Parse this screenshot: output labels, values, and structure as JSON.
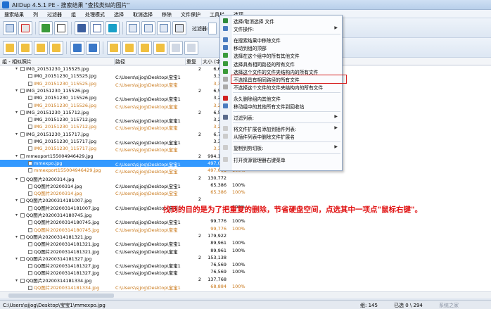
{
  "window": {
    "title": "AllDup 4.5.1 PE - 搜索结果 \"查找类似的图片\""
  },
  "menubar": [
    "搜索结果",
    "列",
    "过滤器",
    "组",
    "处理模式",
    "选择",
    "取消选择",
    "移除",
    "文件保护",
    "工具栏",
    "选项"
  ],
  "toolbar": {
    "filter_label": "过滤器:"
  },
  "columns": {
    "group": "组 - 相似照片",
    "path": "路径",
    "count": "重复",
    "size": "大小 (字节)"
  },
  "rows": [
    {
      "type": "group",
      "name": "IMG_20151230_115525.jpg",
      "count": "2",
      "size": "6,636",
      "pct": ""
    },
    {
      "type": "file",
      "name": "IMG_20151230_115525.jpg",
      "path": "C:\\Users\\sjjog\\Desktop\\宝宝1",
      "size": "3,318",
      "pct": "100%",
      "orange": false
    },
    {
      "type": "file",
      "name": "IMG_20151230_115525.jpg",
      "path": "C:\\Users\\sjjog\\Desktop\\宝宝",
      "size": "3,318",
      "pct": "100%",
      "orange": true
    },
    {
      "type": "group",
      "name": "IMG_20151230_115526.jpg",
      "count": "2",
      "size": "6,544",
      "pct": ""
    },
    {
      "type": "file",
      "name": "IMG_20151230_115526.jpg",
      "path": "C:\\Users\\sjjog\\Desktop\\宝宝1",
      "size": "3,272",
      "pct": "100%",
      "orange": false
    },
    {
      "type": "file",
      "name": "IMG_20151230_115526.jpg",
      "path": "C:\\Users\\sjjog\\Desktop\\宝宝",
      "size": "3,272",
      "pct": "100%",
      "orange": true
    },
    {
      "type": "group",
      "name": "IMG_20151230_115712.jpg",
      "count": "2",
      "size": "6,554",
      "pct": ""
    },
    {
      "type": "file",
      "name": "IMG_20151230_115712.jpg",
      "path": "C:\\Users\\sjjog\\Desktop\\宝宝1",
      "size": "3,277",
      "pct": "100%",
      "orange": false
    },
    {
      "type": "file",
      "name": "IMG_20151230_115712.jpg",
      "path": "C:\\Users\\sjjog\\Desktop\\宝宝",
      "size": "3,277",
      "pct": "100%",
      "orange": true
    },
    {
      "type": "group",
      "name": "IMG_20151230_115717.jpg",
      "count": "2",
      "size": "6,710",
      "pct": ""
    },
    {
      "type": "file",
      "name": "IMG_20151230_115717.jpg",
      "path": "C:\\Users\\sjjog\\Desktop\\宝宝1",
      "size": "3,355",
      "pct": "100%",
      "orange": false
    },
    {
      "type": "file",
      "name": "IMG_20151230_115717.jpg",
      "path": "C:\\Users\\sjjog\\Desktop\\宝宝",
      "size": "3,355",
      "pct": "100%",
      "orange": true
    },
    {
      "type": "group",
      "name": "mmexport155004946429.jpg",
      "count": "2",
      "size": "994,102",
      "pct": ""
    },
    {
      "type": "file",
      "name": "mmexpo.jpg",
      "path": "C:\\Users\\sjjog\\Desktop\\宝宝1",
      "size": "497,051",
      "pct": "100%",
      "orange": false,
      "selected": true
    },
    {
      "type": "file",
      "name": "mmexport155004946429.jpg",
      "path": "C:\\Users\\sjjog\\Desktop\\宝宝",
      "size": "497,051",
      "pct": "100%",
      "orange": true
    },
    {
      "type": "group",
      "name": "QQ图片20200314.jpg",
      "count": "2",
      "size": "130,772",
      "pct": ""
    },
    {
      "type": "file",
      "name": "QQ图片20200314.jpg",
      "path": "C:\\Users\\sjjog\\Desktop\\宝宝1",
      "size": "65,386",
      "pct": "100%",
      "orange": false
    },
    {
      "type": "file",
      "name": "QQ图片20200314.jpg",
      "path": "C:\\Users\\sjjog\\Desktop\\宝宝",
      "size": "65,386",
      "pct": "100%",
      "orange": true
    },
    {
      "type": "group",
      "name": "QQ图片20200314181007.jpg",
      "count": "2",
      "size": "",
      "pct": ""
    },
    {
      "type": "file",
      "name": "QQ图片20200314181007.jpg",
      "path": "C:\\Users\\sjjog\\Desktop\\宝宝1",
      "size": "",
      "pct": "100%",
      "orange": false
    },
    {
      "type": "group",
      "name": "QQ图片20200314180745.jpg",
      "count": "",
      "size": "",
      "pct": ""
    },
    {
      "type": "file",
      "name": "QQ图片20200314180745.jpg",
      "path": "C:\\Users\\sjjog\\Desktop\\宝宝1",
      "size": "99,776",
      "pct": "100%",
      "orange": false
    },
    {
      "type": "file",
      "name": "QQ图片20200314180745.jpg",
      "path": "C:\\Users\\sjjog\\Desktop\\宝宝",
      "size": "99,776",
      "pct": "100%",
      "orange": true
    },
    {
      "type": "group",
      "name": "QQ图片20200314181321.jpg",
      "count": "2",
      "size": "179,922",
      "pct": ""
    },
    {
      "type": "file",
      "name": "QQ图片20200314181321.jpg",
      "path": "C:\\Users\\sjjog\\Desktop\\宝宝1",
      "size": "89,961",
      "pct": "100%",
      "orange": false
    },
    {
      "type": "file",
      "name": "QQ图片20200314181321.jpg",
      "path": "C:\\Users\\sjjog\\Desktop\\宝宝",
      "size": "89,961",
      "pct": "100%",
      "orange": false
    },
    {
      "type": "group",
      "name": "QQ图片20200314181327.jpg",
      "count": "2",
      "size": "153,138",
      "pct": ""
    },
    {
      "type": "file",
      "name": "QQ图片20200314181327.jpg",
      "path": "C:\\Users\\sjjog\\Desktop\\宝宝1",
      "size": "76,569",
      "pct": "100%",
      "orange": false
    },
    {
      "type": "file",
      "name": "QQ图片20200314181327.jpg",
      "path": "C:\\Users\\sjjog\\Desktop\\宝宝",
      "size": "76,569",
      "pct": "100%",
      "orange": false
    },
    {
      "type": "group",
      "name": "QQ图片20200314181334.jpg",
      "count": "2",
      "size": "137,768",
      "pct": ""
    },
    {
      "type": "file",
      "name": "QQ图片20200314181334.jpg",
      "path": "C:\\Users\\sjjog\\Desktop\\宝宝1",
      "size": "68,884",
      "pct": "100%",
      "orange": true
    },
    {
      "type": "file",
      "name": "QQ图片20200314181334.jpg",
      "path": "C:\\Users\\sjjog\\Desktop\\宝宝",
      "size": "68,884",
      "pct": "100%",
      "orange": true
    }
  ],
  "context_menu": [
    {
      "label": "选择/取消选择 文件",
      "icon": "checkbox-icon",
      "color": "#2f8a3a"
    },
    {
      "label": "文件操作:",
      "icon": "file-ops-icon",
      "color": "#4a7bbf",
      "submenu": true
    },
    {
      "sep": true
    },
    {
      "label": "在搜索结果中移除文件",
      "icon": "remove-icon",
      "color": "#4a7bbf"
    },
    {
      "label": "移动到组的顶部",
      "icon": "move-top-icon",
      "color": "#4a7bbf"
    },
    {
      "label": "选择在这个组中的所有其他文件",
      "icon": "select-others-icon",
      "color": "#3a9a3a"
    },
    {
      "label": "选择具有相同路径的所有文件",
      "icon": "select-path-icon",
      "color": "#3a9a3a"
    },
    {
      "label": "选择这个文件的文件夹结构内的所有文件",
      "icon": "select-folder-icon",
      "color": "#3a9a3a"
    },
    {
      "label": "不选择具有相同路径的所有文件",
      "icon": "deselect-path-icon",
      "color": "#aaaaaa"
    },
    {
      "label": "不选择这个文件的文件夹结构内的所有文件",
      "icon": "deselect-folder-icon",
      "color": "#aaaaaa"
    },
    {
      "sep": true
    },
    {
      "label": "永久删除组内其他文件",
      "icon": "delete-icon",
      "color": "#d02020"
    },
    {
      "label": "移动组中的其他所有文件到回收站",
      "icon": "recycle-icon",
      "color": "#4a7bbf"
    },
    {
      "sep": true
    },
    {
      "label": "过滤列表:",
      "icon": "filter-icon",
      "color": "#5a6a8a",
      "submenu": true
    },
    {
      "sep": true
    },
    {
      "label": "将文件扩展名添加到插件列表:",
      "icon": "plugin-add-icon",
      "color": "#cccccc",
      "submenu": true
    },
    {
      "label": "从插件列表中删除文件扩展名",
      "icon": "plugin-remove-icon",
      "color": "#cccccc"
    },
    {
      "sep": true
    },
    {
      "label": "复制到剪切板:",
      "icon": "clipboard-icon",
      "color": "#cccccc",
      "submenu": true
    },
    {
      "sep": true
    },
    {
      "label": "打开资源管理器右键菜单",
      "icon": "explorer-icon",
      "color": "#cccccc"
    }
  ],
  "annotation": "找到的目的是为了把重复的删除，节省硬盘空间，点选其中一项点\"鼠标右键\"。",
  "status": {
    "path": "C:\\Users\\sjjog\\Desktop\\宝宝1\\mmexpo.jpg",
    "count": "组: 145",
    "selected": "已选 0 \\ 294",
    "watermark": "系统之家"
  }
}
